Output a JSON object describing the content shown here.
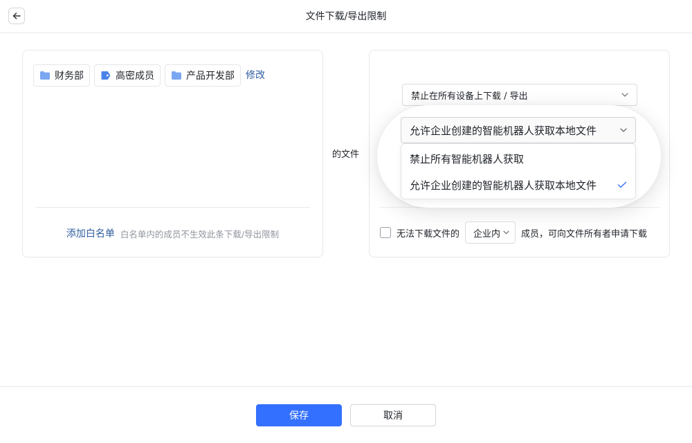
{
  "header": {
    "back_icon": "arrow-left-icon",
    "title": "文件下载/导出限制"
  },
  "whitelist_panel": {
    "tags": [
      {
        "label": "财务部",
        "icon": "folder-icon",
        "icon_color": "#7aa7f2"
      },
      {
        "label": "高密成员",
        "icon": "tag-icon",
        "icon_color": "#4a84ea"
      },
      {
        "label": "产品开发部",
        "icon": "folder-icon",
        "icon_color": "#7aa7f2"
      }
    ],
    "edit_label": "修改",
    "add_whitelist_label": "添加白名单",
    "whitelist_hint": "白名单内的成员不生效此条下载/导出限制"
  },
  "middle_label": "的文件",
  "rules_panel": {
    "download_select_value": "禁止在所有设备上下载 / 导出",
    "bot_select_value": "允许企业创建的智能机器人获取本地文件",
    "bot_dropdown_options": [
      {
        "label": "禁止所有智能机器人获取",
        "selected": false
      },
      {
        "label": "允许企业创建的智能机器人获取本地文件",
        "selected": true
      }
    ],
    "request": {
      "checked": false,
      "prefix": "无法下载文件的",
      "scope_value": "企业内",
      "suffix": "成员，可向文件所有者申请下载"
    }
  },
  "footer": {
    "save_label": "保存",
    "cancel_label": "取消"
  },
  "colors": {
    "primary": "#3370ff",
    "link": "#2f5d9e",
    "check": "#3370ff"
  }
}
